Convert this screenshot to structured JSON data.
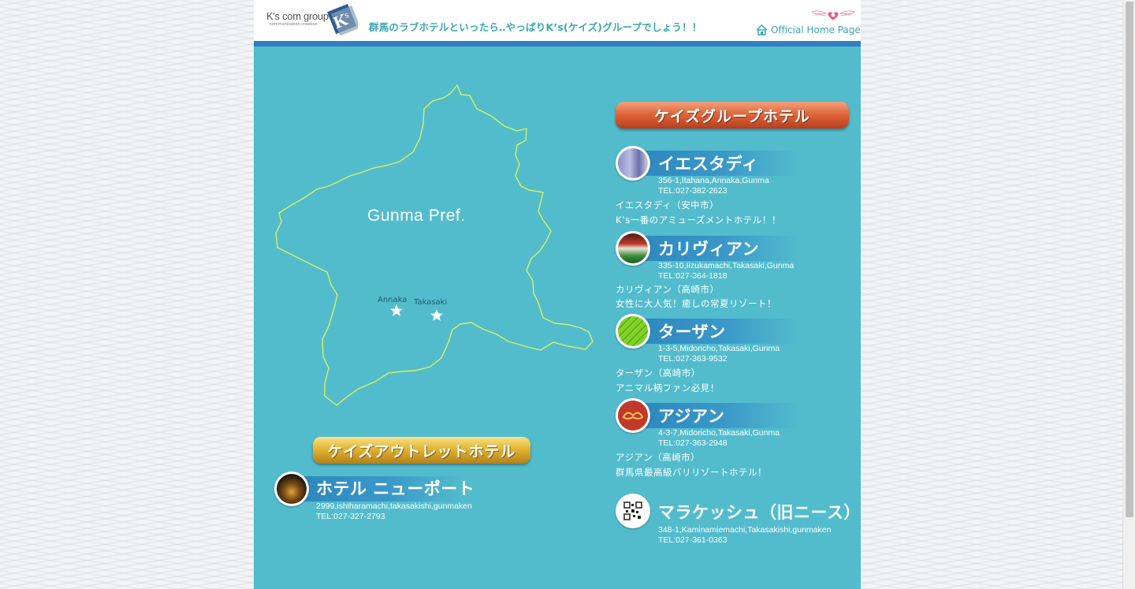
{
  "header": {
    "logo_text": "K's com group",
    "logo_sub": "communication creation",
    "tagline": "群馬のラブホテルといったら‥やっぱりK’s(ケイズ)グループでしょう！！",
    "home_link": "Official Home Page"
  },
  "map": {
    "title": "Gunma Pref.",
    "cities": [
      "Annaka",
      "Takasaki"
    ]
  },
  "group_banner": "ケイズグループホテル",
  "outlet_banner": "ケイズアウトレットホテル",
  "hotels": [
    {
      "name": "イエスタディ",
      "address": "356-1,Itahana,Annaka,Gunma",
      "tel": "TEL:027-382-2623",
      "line1": "イエスタディ（安中市）",
      "line2": "K’s一番のアミューズメントホテル！！",
      "icon": "building-photo-icon"
    },
    {
      "name": "カリヴィアン",
      "address": "335-10,Iizukamachi,Takasaki,Gunma",
      "tel": "TEL:027-364-1818",
      "line1": "カリヴィアン（高崎市）",
      "line2": "女性に大人気！癒しの常夏リゾート！",
      "icon": "resort-photo-icon"
    },
    {
      "name": "ターザン",
      "address": "1-3-5,Midoricho,Takasaki,Gunma",
      "tel": "TEL:027-363-9532",
      "line1": "ターザン（高崎市）",
      "line2": "アニマル柄ファン必見！",
      "icon": "leaf-icon"
    },
    {
      "name": "アジアン",
      "address": "4-3-7,Midoricho,Takasaki,Gunma",
      "tel": "TEL:027-363-2948",
      "line1": "アジアン（高崎市）",
      "line2": "群馬県最高級バリリゾートホテル！",
      "icon": "asian-emblem-icon"
    },
    {
      "name": "マラケッシュ（旧ニース）",
      "address": "348-1,Kaminamiemachi,Takasakishi,gunmaken",
      "tel": "TEL:027-361-0363",
      "icon": "qr-code-icon"
    }
  ],
  "outlet_hotel": {
    "name": "ホテル ニューポート",
    "address": "2999,ishiharamachi,takasakishi,gunmaken",
    "tel": "TEL:027-327-2793",
    "icon": "night-building-photo-icon"
  },
  "colors": {
    "page_bg": "#52bccd",
    "header_bar": "#2f7fc1",
    "map_outline": "#d6f25a",
    "tagline": "#3aa6b6"
  }
}
